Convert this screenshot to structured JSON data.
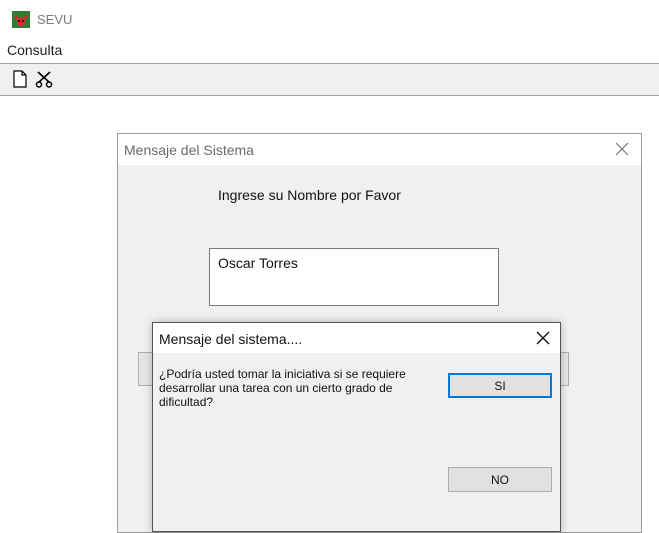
{
  "app": {
    "title": "SEVU",
    "icon": "bull-logo-icon"
  },
  "menu": {
    "items": [
      {
        "label": "Consulta"
      }
    ]
  },
  "toolbar": {
    "buttons": [
      {
        "icon": "new-document-icon"
      },
      {
        "icon": "scissors-icon"
      }
    ]
  },
  "back_dialog": {
    "title": "Mensaje del Sistema",
    "prompt": "Ingrese su Nombre por Favor",
    "name_value": "Oscar Torres"
  },
  "front_dialog": {
    "title": "Mensaje del sistema....",
    "question": "¿Podría usted tomar la iniciativa si se requiere desarrollar una tarea con un cierto grado de dificultad?",
    "yes_label": "SI",
    "no_label": "NO"
  },
  "colors": {
    "focus_border": "#0078d7",
    "dialog_bg": "#f0f0f0",
    "button_bg": "#e1e1e1"
  }
}
